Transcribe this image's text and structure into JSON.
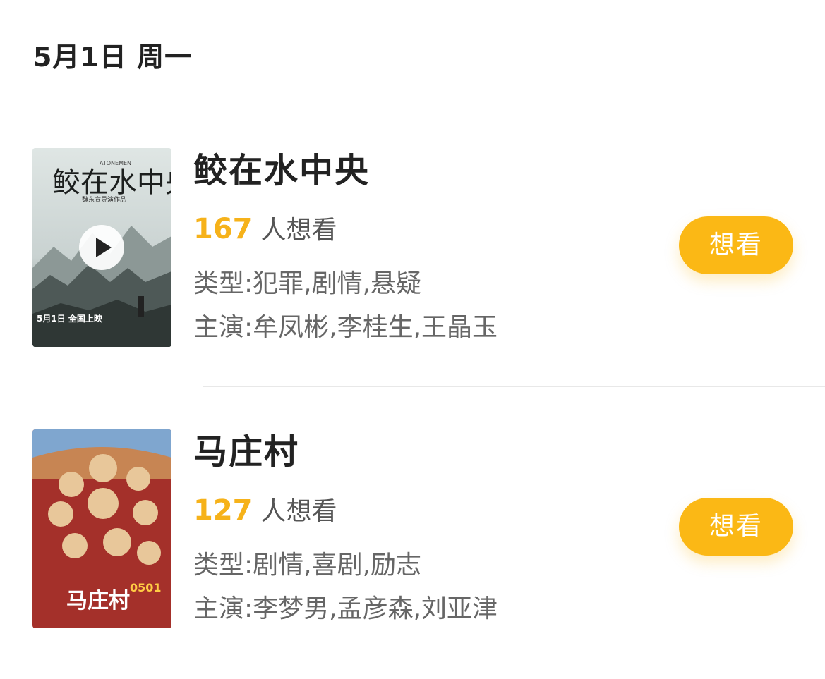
{
  "date_header": "5月1日 周一",
  "colors": {
    "accent": "#f6b21a",
    "button_bg": "#fbb815",
    "button_text": "#ffffff",
    "title": "#222222",
    "secondary": "#666666"
  },
  "movies": [
    {
      "title": "鲛在水中央",
      "wish_count": "167",
      "wish_label": "人想看",
      "genre": "类型:犯罪,剧情,悬疑",
      "cast": "主演:牟凤彬,李桂生,王晶玉",
      "button_label": "想看",
      "poster": {
        "icon": "play-icon",
        "title_text": "鲛在水中央",
        "english_text": "ATONEMENT",
        "credit_text": "魏东宣导演作品",
        "release_text": "5月1日 全国上映"
      }
    },
    {
      "title": "马庄村",
      "wish_count": "127",
      "wish_label": "人想看",
      "genre": "类型:剧情,喜剧,励志",
      "cast": "主演:李梦男,孟彦森,刘亚津",
      "button_label": "想看",
      "poster": {
        "title_text": "马庄村",
        "date_text": "0501"
      }
    }
  ]
}
